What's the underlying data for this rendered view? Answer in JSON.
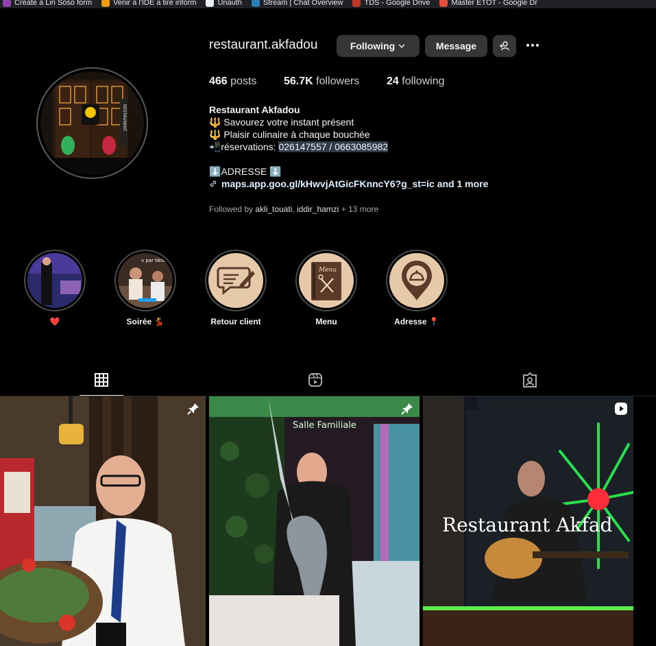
{
  "bookmarks": [
    {
      "label": "Créate a Lin Soso form",
      "color": "#8e44ad"
    },
    {
      "label": "Venir a l'IDE a tire inform",
      "color": "#f39c12"
    },
    {
      "label": "Unauth",
      "color": "#ecf0f1"
    },
    {
      "label": "Stream | Chat Overview",
      "color": "#2980b9"
    },
    {
      "label": "TDS - Google Drive",
      "color": "#c0392b"
    },
    {
      "label": "Master ETOT - Google Dr",
      "color": "#e74c3c"
    }
  ],
  "profile": {
    "username": "restaurant.akfadou",
    "following_label": "Following",
    "message_label": "Message",
    "stats": {
      "posts_count": "466",
      "posts_label": "posts",
      "followers_count": "56.7K",
      "followers_label": "followers",
      "following_count": "24",
      "following_label": "following"
    },
    "bio": {
      "name": "Restaurant Akfadou",
      "line1": "🔱 Savourez votre instant présent",
      "line2": "🔱 Plaisir culinaire à chaque bouchée",
      "line3_prefix": "📲réservations: ",
      "line3_phones": "026147557 / 0663085982",
      "line4": "⬇️ADRESSE ⬇️",
      "link": "maps.app.goo.gl/kHwvjAtGicFKnncY6?g_st=ic and 1 more"
    },
    "followed_by": {
      "prefix": "Followed by ",
      "user1": "akli_touati",
      "sep": ", ",
      "user2": "iddir_hamzi",
      "suffix": " + 13 more"
    }
  },
  "highlights": [
    {
      "label": "❤️"
    },
    {
      "label": "Soirée 💃"
    },
    {
      "label": "Retour client"
    },
    {
      "label": "Menu"
    },
    {
      "label": "Adresse 📍"
    }
  ],
  "highlight_texts": {
    "soiree_overlay": "v par tiktok",
    "menu_word": "Menu"
  },
  "posts": [
    {
      "type": "pinned"
    },
    {
      "type": "pinned",
      "sign": "Salle Familiale"
    },
    {
      "type": "reel",
      "overlay": "Restaurant Akfad"
    }
  ],
  "colors": {
    "accent_link": "#e0f1ff",
    "button_bg": "#363636",
    "highlight_beige": "#e6c9a8",
    "icon_brown": "#5b3a29"
  }
}
